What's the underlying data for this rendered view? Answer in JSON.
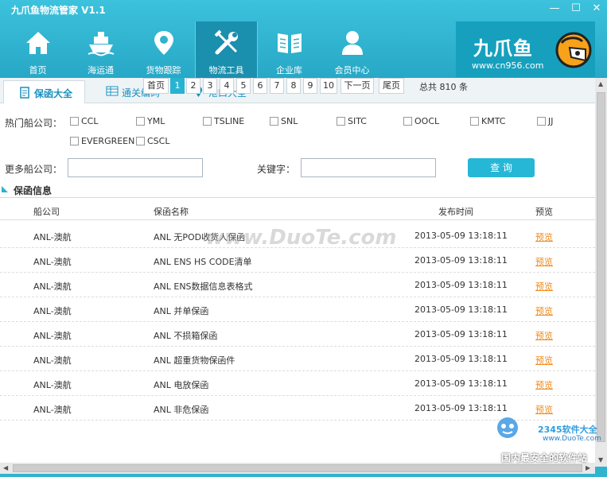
{
  "window": {
    "title": "九爪鱼物流管家 V1.1",
    "min": "—",
    "max": "☐",
    "close": "✕"
  },
  "nav": [
    {
      "label": "首页",
      "icon": "home-icon"
    },
    {
      "label": "海运通",
      "icon": "ship-icon"
    },
    {
      "label": "货物跟踪",
      "icon": "location-pin-icon"
    },
    {
      "label": "物流工具",
      "icon": "tools-icon",
      "active": true
    },
    {
      "label": "企业库",
      "icon": "book-icon"
    },
    {
      "label": "会员中心",
      "icon": "user-icon"
    }
  ],
  "logo": {
    "name": "九爪鱼",
    "url": "www.cn956.com"
  },
  "subtabs": [
    {
      "label": "保函大全",
      "active": true
    },
    {
      "label": "通关编码"
    },
    {
      "label": "港口大全"
    }
  ],
  "filters": {
    "hot_label": "热门船公司：",
    "hot_companies": [
      "CCL",
      "YML",
      "TSLINE",
      "SNL",
      "SITC",
      "OOCL",
      "KMTC",
      "JJ",
      "EVERGREEN",
      "CSCL"
    ],
    "more_label": "更多船公司：",
    "keyword_label": "关键字：",
    "query_button": "查 询"
  },
  "section_title": "保函信息",
  "table": {
    "headers": [
      "船公司",
      "保函名称",
      "发布时间",
      "预览"
    ],
    "rows": [
      {
        "company": "ANL-澳航",
        "name": "ANL 无POD收货人保函",
        "time": "2013-05-09 13:18:11",
        "preview": "预览"
      },
      {
        "company": "ANL-澳航",
        "name": "ANL ENS HS CODE清单",
        "time": "2013-05-09 13:18:11",
        "preview": "预览"
      },
      {
        "company": "ANL-澳航",
        "name": "ANL ENS数据信息表格式",
        "time": "2013-05-09 13:18:11",
        "preview": "预览"
      },
      {
        "company": "ANL-澳航",
        "name": "ANL 并单保函",
        "time": "2013-05-09 13:18:11",
        "preview": "预览"
      },
      {
        "company": "ANL-澳航",
        "name": "ANL 不损箱保函",
        "time": "2013-05-09 13:18:11",
        "preview": "预览"
      },
      {
        "company": "ANL-澳航",
        "name": "ANL 超重货物保函件",
        "time": "2013-05-09 13:18:11",
        "preview": "预览"
      },
      {
        "company": "ANL-澳航",
        "name": "ANL 电放保函",
        "time": "2013-05-09 13:18:11",
        "preview": "预览"
      },
      {
        "company": "ANL-澳航",
        "name": "ANL 非危保函",
        "time": "2013-05-09 13:18:11",
        "preview": "预览"
      }
    ]
  },
  "pager": {
    "first": "首页",
    "pages": [
      "1",
      "2",
      "3",
      "4",
      "5",
      "6",
      "7",
      "8",
      "9",
      "10"
    ],
    "current": "1",
    "next": "下一页",
    "last": "尾页",
    "total": "总共 810 条"
  },
  "watermark": "www.DuoTe.com",
  "badge": {
    "brand": "2345软件大全",
    "site": "www.DuoTe.com",
    "tagline": "国内最安全的软件站"
  }
}
